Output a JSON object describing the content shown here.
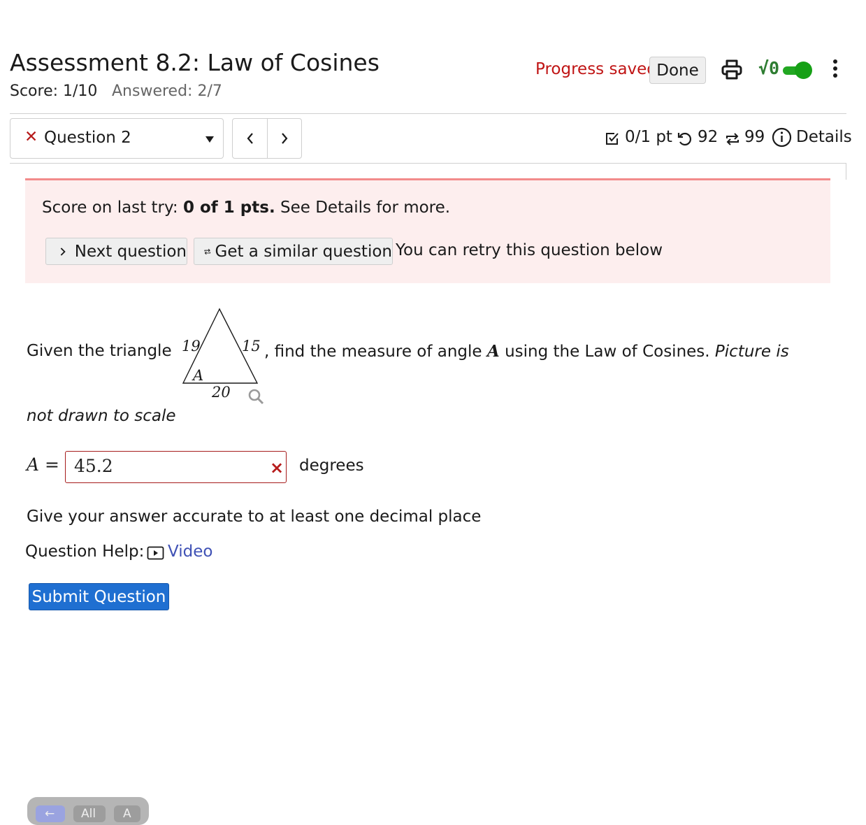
{
  "header": {
    "title": "Assessment 8.2: Law of Cosines",
    "score": "Score: 1/10",
    "answered": "Answered: 2/7",
    "progress_saved": "Progress saved",
    "done_label": "Done",
    "sqrt_label": "√0"
  },
  "nav": {
    "question_label": "Question 2",
    "points": "0/1 pt",
    "retries": "92",
    "similar": "99",
    "details": "Details"
  },
  "alert": {
    "prefix": "Score on last try: ",
    "score": "0 of 1 pts.",
    "suffix": " See Details for more.",
    "next_question": "Next question",
    "similar_question": "Get a similar question",
    "retry_text": "You can retry this question below"
  },
  "question": {
    "given": "Given the triangle",
    "find_prefix": ", find the measure of angle",
    "angle_var": "A",
    "find_suffix": "using the Law of Cosines.",
    "note_start": "Picture is",
    "note_end": "not drawn to scale",
    "triangle": {
      "left_side": "19",
      "right_side": "15",
      "base": "20",
      "angle_label": "A"
    },
    "answer_var": "A",
    "answer_value": "45.2",
    "answer_error": "×",
    "unit": "degrees",
    "instruction": "Give your answer accurate to at least one decimal place",
    "help_label": "Question Help:",
    "video_label": "Video",
    "submit_label": "Submit Question"
  },
  "footer": {
    "pill_1": "←",
    "pill_2": "All",
    "pill_3": "A"
  },
  "colors": {
    "accent": "#1f6fd1",
    "error": "#c01515",
    "alert_bg": "#fdeeee",
    "toggle_on": "#16a016"
  }
}
